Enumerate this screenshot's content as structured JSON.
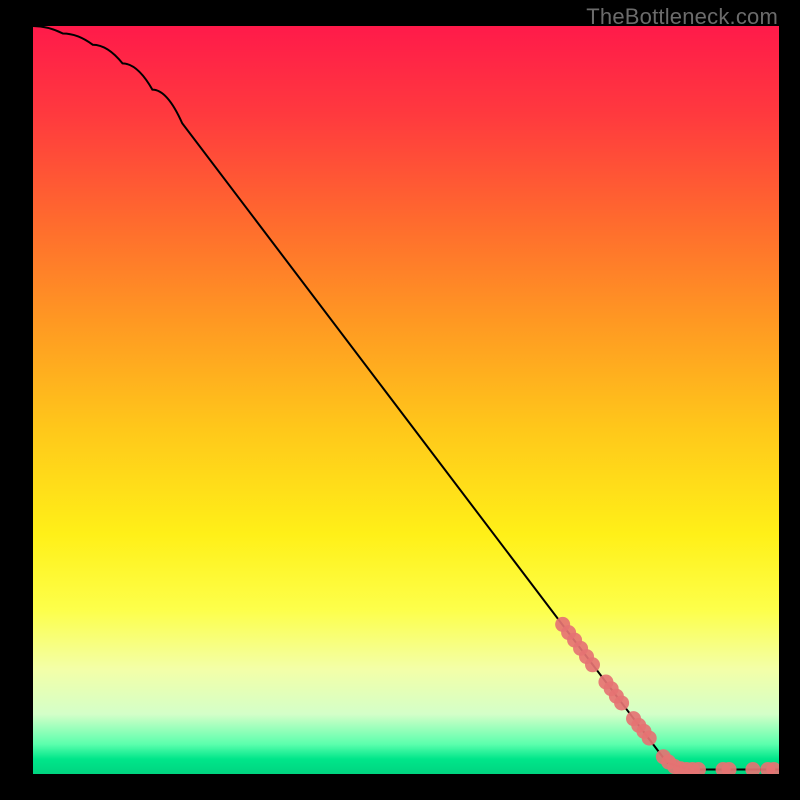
{
  "attribution": "TheBottleneck.com",
  "chart_data": {
    "type": "line",
    "title": "",
    "xlabel": "",
    "ylabel": "",
    "xlim": [
      0,
      100
    ],
    "ylim": [
      0,
      100
    ],
    "curve": [
      {
        "x": 0,
        "y": 100
      },
      {
        "x": 4,
        "y": 99
      },
      {
        "x": 8,
        "y": 97.5
      },
      {
        "x": 12,
        "y": 95
      },
      {
        "x": 16,
        "y": 91.5
      },
      {
        "x": 20,
        "y": 87
      },
      {
        "x": 85,
        "y": 1.5
      },
      {
        "x": 88,
        "y": 0.6
      },
      {
        "x": 100,
        "y": 0.6
      }
    ],
    "markers": [
      {
        "x": 71.0,
        "y": 20.0
      },
      {
        "x": 71.8,
        "y": 18.9
      },
      {
        "x": 72.6,
        "y": 17.9
      },
      {
        "x": 73.4,
        "y": 16.8
      },
      {
        "x": 74.2,
        "y": 15.7
      },
      {
        "x": 75.0,
        "y": 14.6
      },
      {
        "x": 76.8,
        "y": 12.3
      },
      {
        "x": 77.5,
        "y": 11.4
      },
      {
        "x": 78.2,
        "y": 10.4
      },
      {
        "x": 78.9,
        "y": 9.5
      },
      {
        "x": 80.5,
        "y": 7.4
      },
      {
        "x": 81.2,
        "y": 6.5
      },
      {
        "x": 81.9,
        "y": 5.7
      },
      {
        "x": 82.6,
        "y": 4.8
      },
      {
        "x": 84.5,
        "y": 2.3
      },
      {
        "x": 85.2,
        "y": 1.6
      },
      {
        "x": 86.0,
        "y": 1.0
      },
      {
        "x": 86.8,
        "y": 0.7
      },
      {
        "x": 87.6,
        "y": 0.6
      },
      {
        "x": 88.4,
        "y": 0.6
      },
      {
        "x": 89.2,
        "y": 0.6
      },
      {
        "x": 92.5,
        "y": 0.6
      },
      {
        "x": 93.3,
        "y": 0.6
      },
      {
        "x": 96.5,
        "y": 0.6
      },
      {
        "x": 98.5,
        "y": 0.6
      },
      {
        "x": 99.3,
        "y": 0.6
      }
    ],
    "marker_color": "#e57373",
    "marker_alpha": 0.92,
    "line_color": "#000000"
  }
}
